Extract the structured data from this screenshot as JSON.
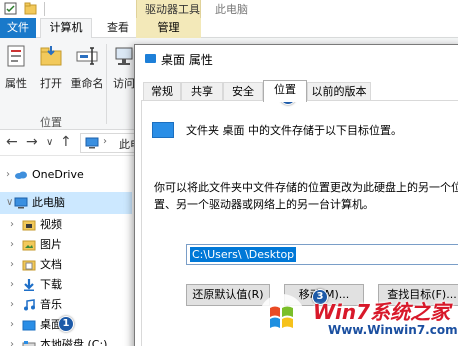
{
  "explorer": {
    "contextual_group": "驱动器工具",
    "title": "此电脑",
    "tabs": {
      "file": "文件",
      "computer": "计算机",
      "view": "查看",
      "manage": "管理"
    },
    "ribbon": {
      "buttons": [
        "属性",
        "打开",
        "重命名",
        "访问"
      ],
      "group_label": "位置"
    },
    "address": "此电",
    "nav": {
      "onedrive": "OneDrive",
      "this_pc": "此电脑",
      "items": [
        "视频",
        "图片",
        "文档",
        "下载",
        "音乐",
        "桌面",
        "本地磁盘 (C:)"
      ]
    }
  },
  "dialog": {
    "title": "桌面 属性",
    "tabs": [
      "常规",
      "共享",
      "安全",
      "位置",
      "以前的版本"
    ],
    "active_tab": "位置",
    "folder_description": "文件夹 桌面 中的文件存储于以下目标位置。",
    "move_description": "你可以将此文件夹中文件存储的位置更改为此硬盘上的另一个位置、另一个驱动器或网络上的另一台计算机。",
    "path_value": "C:\\Users\\        \\Desktop",
    "buttons": {
      "restore": "还原默认值(R)",
      "move": "移动(M)...",
      "find_target": "查找目标(F)..."
    }
  },
  "badges": {
    "desktop_step": "1",
    "location_tab_step": "2",
    "move_step": "3"
  },
  "watermark": {
    "brand": "Win7系统之家",
    "url": "Www.Winwin7.com"
  },
  "colors": {
    "accent": "#0078d7",
    "file_tab": "#1979ca",
    "contextual": "#f3e9b9",
    "badge": "#1d5aa8",
    "watermark_red": "#d8192a"
  }
}
